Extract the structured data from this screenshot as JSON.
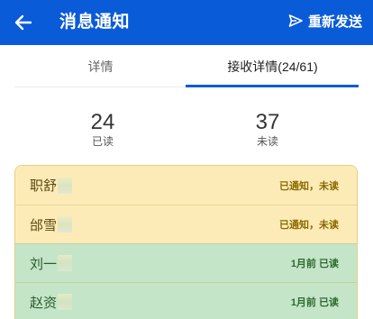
{
  "header": {
    "title": "消息通知",
    "resend_label": "重新发送",
    "background": "#0a5bd8"
  },
  "tabs": [
    {
      "label": "详情",
      "active": false
    },
    {
      "label": "接收详情(24/61)",
      "active": true
    }
  ],
  "stats": {
    "read": {
      "value": "24",
      "label": "已读"
    },
    "unread": {
      "value": "37",
      "label": "未读"
    }
  },
  "recipients": [
    {
      "name": "职舒",
      "status": "已通知，未读",
      "state": "pending"
    },
    {
      "name": "邰雪",
      "status": "已通知，未读",
      "state": "pending"
    },
    {
      "name": "刘一",
      "status": "1月前 已读",
      "state": "done"
    },
    {
      "name": "赵资",
      "status": "1月前 已读",
      "state": "done"
    }
  ],
  "colors": {
    "accent": "#0a5bd8",
    "pending_bg": "#fdebb7",
    "done_bg": "#c4e5c8"
  }
}
